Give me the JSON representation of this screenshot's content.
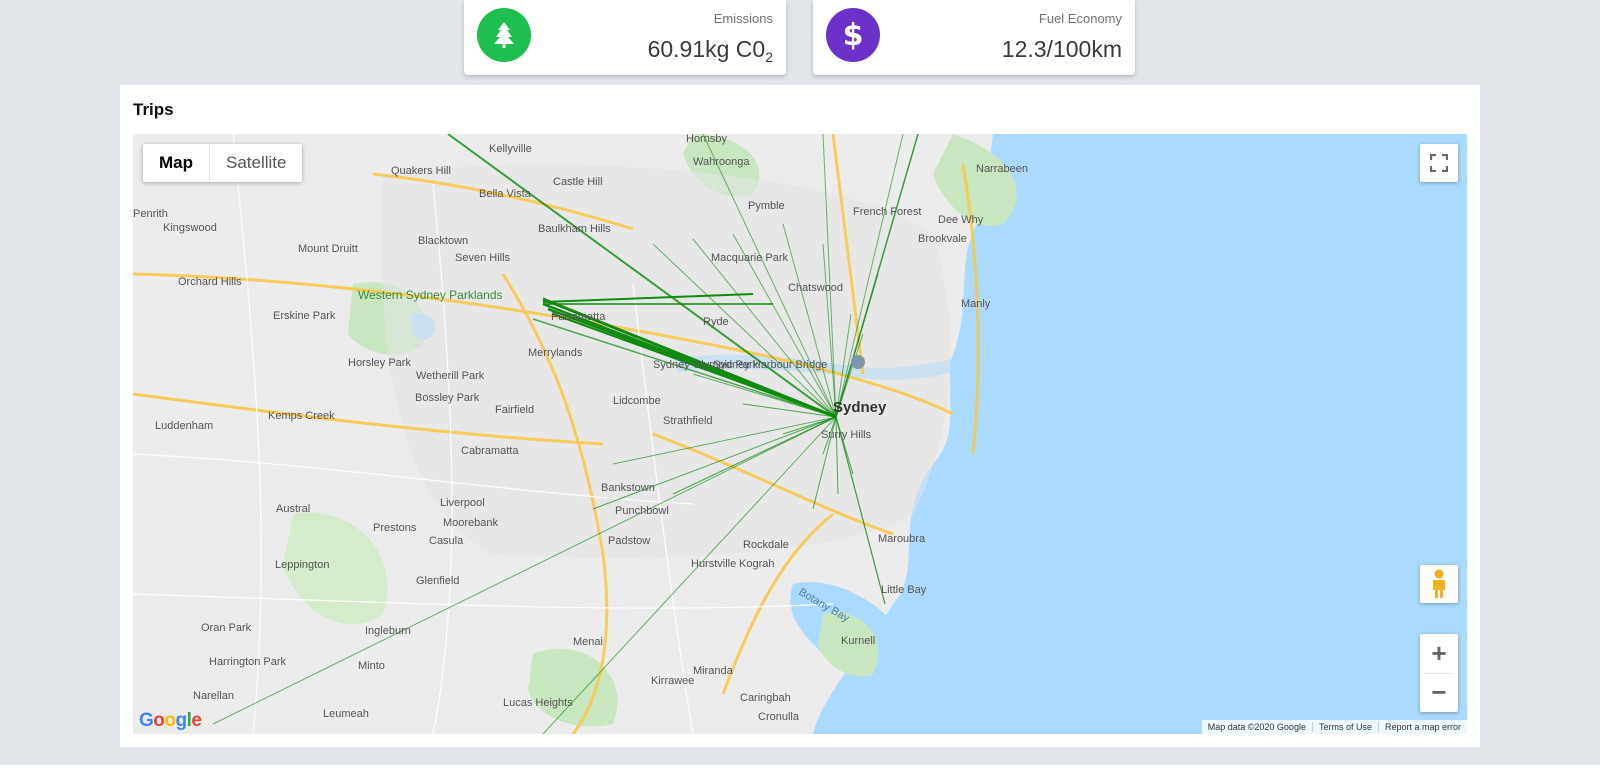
{
  "cards": {
    "emissions": {
      "label": "Emissions",
      "value": "60.91kg C0",
      "subscript": "2",
      "icon": "tree-icon",
      "color": "#1fbf4f"
    },
    "fuel": {
      "label": "Fuel Economy",
      "value": "12.3/100km",
      "icon": "dollar-icon",
      "color": "#6a32c8"
    }
  },
  "trips": {
    "title": "Trips",
    "map_type": {
      "map": "Map",
      "satellite": "Satellite"
    },
    "attribution": {
      "data": "Map data ©2020 Google",
      "terms": "Terms of Use",
      "report": "Report a map error"
    },
    "logo": "Google"
  },
  "places": [
    "Kellyville",
    "Hornsby",
    "Quakers Hill",
    "Wahroonga",
    "Narrabeen",
    "Bella Vista",
    "Castle Hill",
    "Penrith",
    "Kingswood",
    "Pymble",
    "French Forest",
    "Dee Why",
    "Baulkham Hills",
    "Blacktown",
    "Brookvale",
    "Mount Druitt",
    "Seven Hills",
    "Macquarie Park",
    "Orchard Hills",
    "Chatswood",
    "Manly",
    "Western Sydney Parklands",
    "Erskine Park",
    "Parramatta",
    "Ryde",
    "Merrylands",
    "Horsley Park",
    "Sydney Olympic Park",
    "Sydney Harbour Bridge",
    "Wetherill Park",
    "Sydney",
    "Bossley Park",
    "Fairfield",
    "Lidcombe",
    "Kemps Creek",
    "Strathfield",
    "Surry Hills",
    "Luddenham",
    "Cabramatta",
    "Bankstown",
    "Austral",
    "Liverpool",
    "Moorebank",
    "Punchbowl",
    "Prestons",
    "Casula",
    "Padstow",
    "Maroubra",
    "Rockdale",
    "Hurstville",
    "Kograh",
    "Leppington",
    "Glenfield",
    "Little Bay",
    "Botany Bay",
    "Oran Park",
    "Ingleburn",
    "Menai",
    "Kurnell",
    "Harrington Park",
    "Minto",
    "Kirrawee",
    "Miranda",
    "Narellan",
    "Caringbah",
    "Lucas Heights",
    "Leumeah",
    "Cronulla"
  ]
}
